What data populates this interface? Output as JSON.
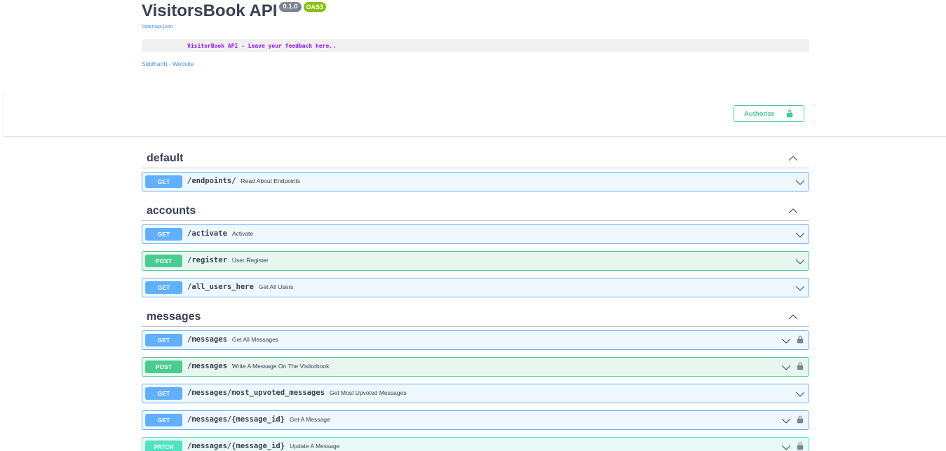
{
  "info": {
    "title": "VisitorsBook API",
    "version": "0.1.0",
    "oas": "OAS3",
    "openapi_link": "/openapi.json",
    "description": "VisitorBook API - Leave your feedback here..",
    "external_link": "Siddharth - Website"
  },
  "authorize": {
    "label": "Authorize"
  },
  "tags": [
    {
      "name": "default"
    },
    {
      "name": "accounts"
    },
    {
      "name": "messages"
    }
  ],
  "operations": [
    {
      "method": "GET",
      "path": "/endpoints/",
      "summary": "Read About Endpoints",
      "locked": false
    },
    {
      "method": "GET",
      "path": "/activate",
      "summary": "Activate",
      "locked": false
    },
    {
      "method": "POST",
      "path": "/register",
      "summary": "User Register",
      "locked": false
    },
    {
      "method": "GET",
      "path": "/all_users_here",
      "summary": "Get All Users",
      "locked": false
    },
    {
      "method": "GET",
      "path": "/messages",
      "summary": "Get All Messages",
      "locked": true
    },
    {
      "method": "POST",
      "path": "/messages",
      "summary": "Write A Message On The Visitorbook",
      "locked": true
    },
    {
      "method": "GET",
      "path": "/messages/most_upvoted_messages",
      "summary": "Get Most Upvoted Messages",
      "locked": false
    },
    {
      "method": "GET",
      "path": "/messages/{message_id}",
      "summary": "Get A Message",
      "locked": true
    },
    {
      "method": "PATCH",
      "path": "/messages/{message_id}",
      "summary": "Update A Message",
      "locked": true
    }
  ],
  "colors": {
    "get": "#61affe",
    "post": "#49cc90",
    "patch": "#50e3c2",
    "authorize": "#49cc90",
    "link": "#4990e2",
    "description": "#9012fe"
  }
}
